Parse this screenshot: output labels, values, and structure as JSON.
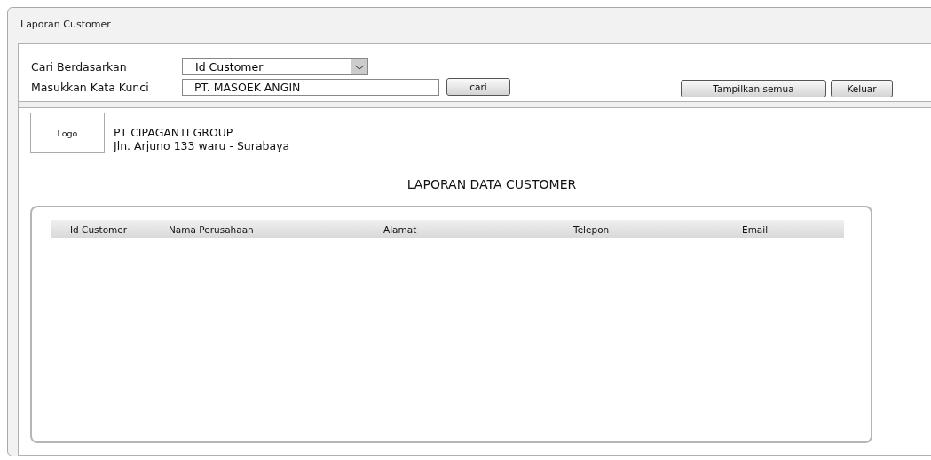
{
  "window": {
    "title": "Laporan Customer"
  },
  "search": {
    "by_label": "Cari Berdasarkan",
    "by_value": "Id Customer",
    "keyword_label": "Masukkan Kata Kunci",
    "keyword_value": "PT. MASOEK ANGIN",
    "search_button": "cari"
  },
  "buttons": [
    "Tampilkan semua",
    "Keluar"
  ],
  "report": {
    "logo": "Logo",
    "company": "PT CIPAGANTI GROUP",
    "address": "Jln. Arjuno 133 waru - Surabaya",
    "title": "LAPORAN DATA CUSTOMER",
    "columns": [
      "Id Customer",
      "Nama Perusahaan",
      "Alamat",
      "Telepon",
      "Email"
    ]
  }
}
